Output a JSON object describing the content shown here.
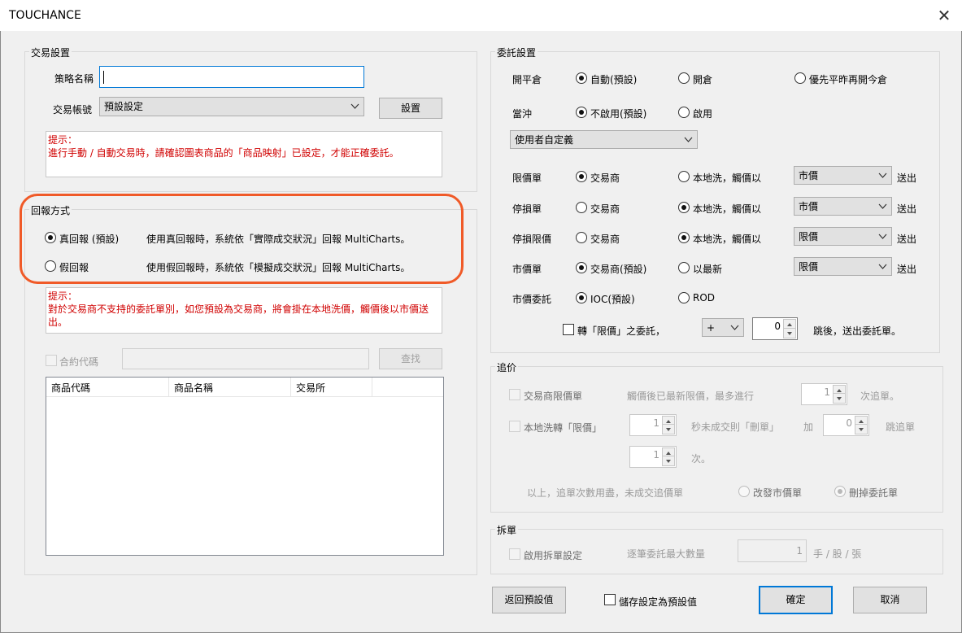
{
  "window": {
    "title": "TOUCHANCE"
  },
  "trade_settings": {
    "group_label": "交易設置",
    "strategy_name_label": "策略名稱",
    "strategy_name_value": "",
    "account_label": "交易帳號",
    "account_value": "預設設定",
    "settings_button": "設置",
    "hint_title": "提示：",
    "hint_text": "進行手動 / 自動交易時，請確認圖表商品的「商品映射」已設定，才能正確委託。"
  },
  "report_mode": {
    "group_label": "回報方式",
    "real": {
      "label": "真回報 (預設)",
      "desc": "使用真回報時，系統依「實際成交狀況」回報 MultiCharts。",
      "checked": true
    },
    "fake": {
      "label": "假回報",
      "desc": "使用假回報時，系統依「模擬成交狀況」回報 MultiCharts。",
      "checked": false
    },
    "hint_title": "提示：",
    "hint_text": "對於交易商不支持的委託單別，如您預設為交易商，將會掛在本地洗價，觸價後以市價送出。",
    "contract_code_label": "合約代碼",
    "search_button": "查找",
    "table_columns": [
      "商品代碼",
      "商品名稱",
      "交易所"
    ]
  },
  "order_settings": {
    "group_label": "委託設置",
    "open_close": {
      "label": "開平倉",
      "options": [
        "自動(預設)",
        "開倉",
        "優先平昨再開今倉"
      ],
      "selected": 0
    },
    "day_trade": {
      "label": "當沖",
      "options": [
        "不啟用(預設)",
        "啟用"
      ],
      "selected": 0
    },
    "user_define_combo": "使用者自定義",
    "send_label": "送出",
    "rows": [
      {
        "label": "限價單",
        "opt1": "交易商",
        "opt2": "本地洗，觸價以",
        "selected": 1,
        "combo": "市價"
      },
      {
        "label": "停損單",
        "opt1": "交易商",
        "opt2": "本地洗，觸價以",
        "selected": 2,
        "combo": "市價"
      },
      {
        "label": "停損限價",
        "opt1": "交易商",
        "opt2": "本地洗，觸價以",
        "selected": 2,
        "combo": "限價"
      },
      {
        "label": "市價單",
        "opt1": "交易商(預設)",
        "opt2": "以最新",
        "selected": 1,
        "combo": "限價"
      }
    ],
    "market_order": {
      "label": "市價委託",
      "options": [
        "IOC(預設)",
        "ROD"
      ],
      "selected": 0
    },
    "convert_label": "轉「限價」之委託，",
    "sign_combo": "+",
    "tick_value": "0",
    "tick_suffix": "跳後，送出委託單。"
  },
  "chase": {
    "group_label": "追价",
    "broker_limit_label": "交易商限價單",
    "after_touch_text": "觸價後已最新限價，最多進行",
    "times1_value": "1",
    "times1_suffix": "次追單。",
    "local_convert_label": "本地洗轉「限價」",
    "seconds_value": "1",
    "seconds_text": "秒未成交則「刪單」",
    "plus_label": "加",
    "ticks_value": "0",
    "ticks_suffix": "跳追單",
    "times2_value": "1",
    "times2_suffix": "次。",
    "exhausted_text": "以上，追單次數用盡，未成交追價單",
    "opt_market": "改發市價單",
    "opt_delete": "刪掉委託單"
  },
  "split": {
    "group_label": "拆單",
    "enable_label": "啟用拆單設定",
    "max_qty_label": "逐筆委託最大數量",
    "max_qty_value": "1",
    "unit_label": "手 / 股 / 張"
  },
  "footer": {
    "reset_button": "返回預設值",
    "save_default_label": "儲存設定為預設值",
    "ok_button": "確定",
    "cancel_button": "取消"
  }
}
